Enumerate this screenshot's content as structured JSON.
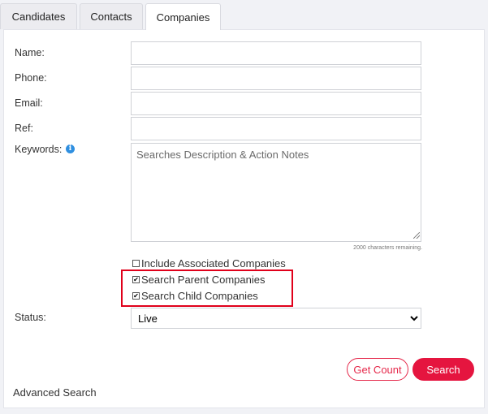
{
  "tabs": [
    {
      "label": "Candidates",
      "active": false
    },
    {
      "label": "Contacts",
      "active": false
    },
    {
      "label": "Companies",
      "active": true
    }
  ],
  "form": {
    "name_label": "Name:",
    "phone_label": "Phone:",
    "email_label": "Email:",
    "ref_label": "Ref:",
    "keywords_label": "Keywords:",
    "keywords_placeholder": "Searches Description & Action Notes",
    "chars_remaining": "2000 characters remaining.",
    "include_associated_label": "Include Associated Companies",
    "include_associated_checked": false,
    "search_parent_label": "Search Parent Companies",
    "search_parent_checked": true,
    "search_child_label": "Search Child Companies",
    "search_child_checked": true,
    "status_label": "Status:",
    "status_value": "Live",
    "status_options": [
      "Live"
    ]
  },
  "buttons": {
    "get_count": "Get Count",
    "search": "Search"
  },
  "advanced_search": "Advanced Search",
  "colors": {
    "accent": "#e5153f",
    "highlight": "#e0001a",
    "info": "#2f8fe0"
  }
}
